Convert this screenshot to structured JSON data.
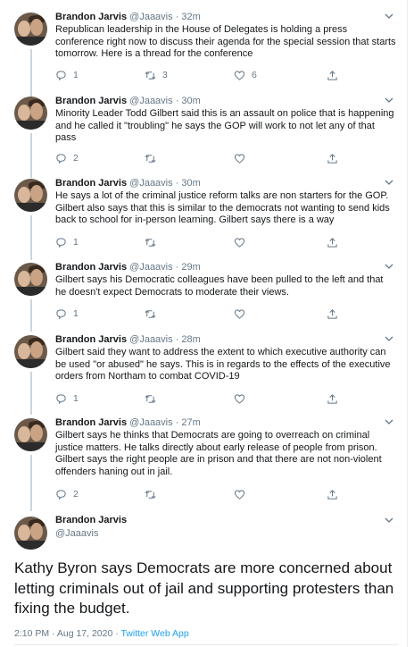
{
  "thread": {
    "replies": [
      {
        "name": "Brandon Jarvis",
        "handle": "@Jaaavis",
        "time": "32m",
        "text": "Republican leadership in the House of Delegates is holding a press conference right now to discuss their agenda for the special session that starts tomorrow. Here is a thread for the conference",
        "reply_count": "1",
        "retweet_count": "3",
        "like_count": "6"
      },
      {
        "name": "Brandon Jarvis",
        "handle": "@Jaaavis",
        "time": "30m",
        "text": "Minority Leader Todd Gilbert said this is an assault on police that is happening and he called it \"troubling\" he says the GOP will work to not let any of that pass",
        "reply_count": "2",
        "retweet_count": "",
        "like_count": ""
      },
      {
        "name": "Brandon Jarvis",
        "handle": "@Jaaavis",
        "time": "30m",
        "text": "He says a lot of the criminal justice reform talks are non starters for the GOP. Gilbert also says that this is similar to the democrats not wanting to send kids back to school for in-person learning. Gilbert says there is a way",
        "reply_count": "1",
        "retweet_count": "",
        "like_count": ""
      },
      {
        "name": "Brandon Jarvis",
        "handle": "@Jaaavis",
        "time": "29m",
        "text": "Gilbert says his Democratic colleagues have been pulled to the left and that he doesn't expect Democrats to moderate their views.",
        "reply_count": "1",
        "retweet_count": "",
        "like_count": ""
      },
      {
        "name": "Brandon Jarvis",
        "handle": "@Jaaavis",
        "time": "28m",
        "text": "Gilbert said they want to address the extent to which executive authority can be used \"or abused\" he says.  This is in regards to the effects of the executive orders from Northam to combat COVID-19",
        "reply_count": "1",
        "retweet_count": "",
        "like_count": ""
      },
      {
        "name": "Brandon Jarvis",
        "handle": "@Jaaavis",
        "time": "27m",
        "text": "Gilbert says he thinks that Democrats are going to overreach on criminal justice matters. He talks directly about early release of people from prison. Gilbert says the right people are in prison and that there are not non-violent offenders haning out in jail.",
        "reply_count": "2",
        "retweet_count": "",
        "like_count": ""
      }
    ],
    "main": {
      "name": "Brandon Jarvis",
      "handle": "@Jaaavis",
      "text": "Kathy Byron says Democrats are more concerned about letting criminals out of jail and supporting protesters than fixing the budget.",
      "timestamp": "2:10 PM · Aug 17, 2020 · ",
      "via": "Twitter Web App"
    }
  },
  "icons": {
    "reply": "reply-icon",
    "retweet": "retweet-icon",
    "like": "like-icon",
    "share": "share-icon",
    "caret": "chevron-down-icon"
  },
  "colors": {
    "text": "#14171a",
    "secondary": "#657786",
    "link": "#1da1f2",
    "border": "#e6ecf0",
    "thread_line": "#ccd6dd"
  }
}
